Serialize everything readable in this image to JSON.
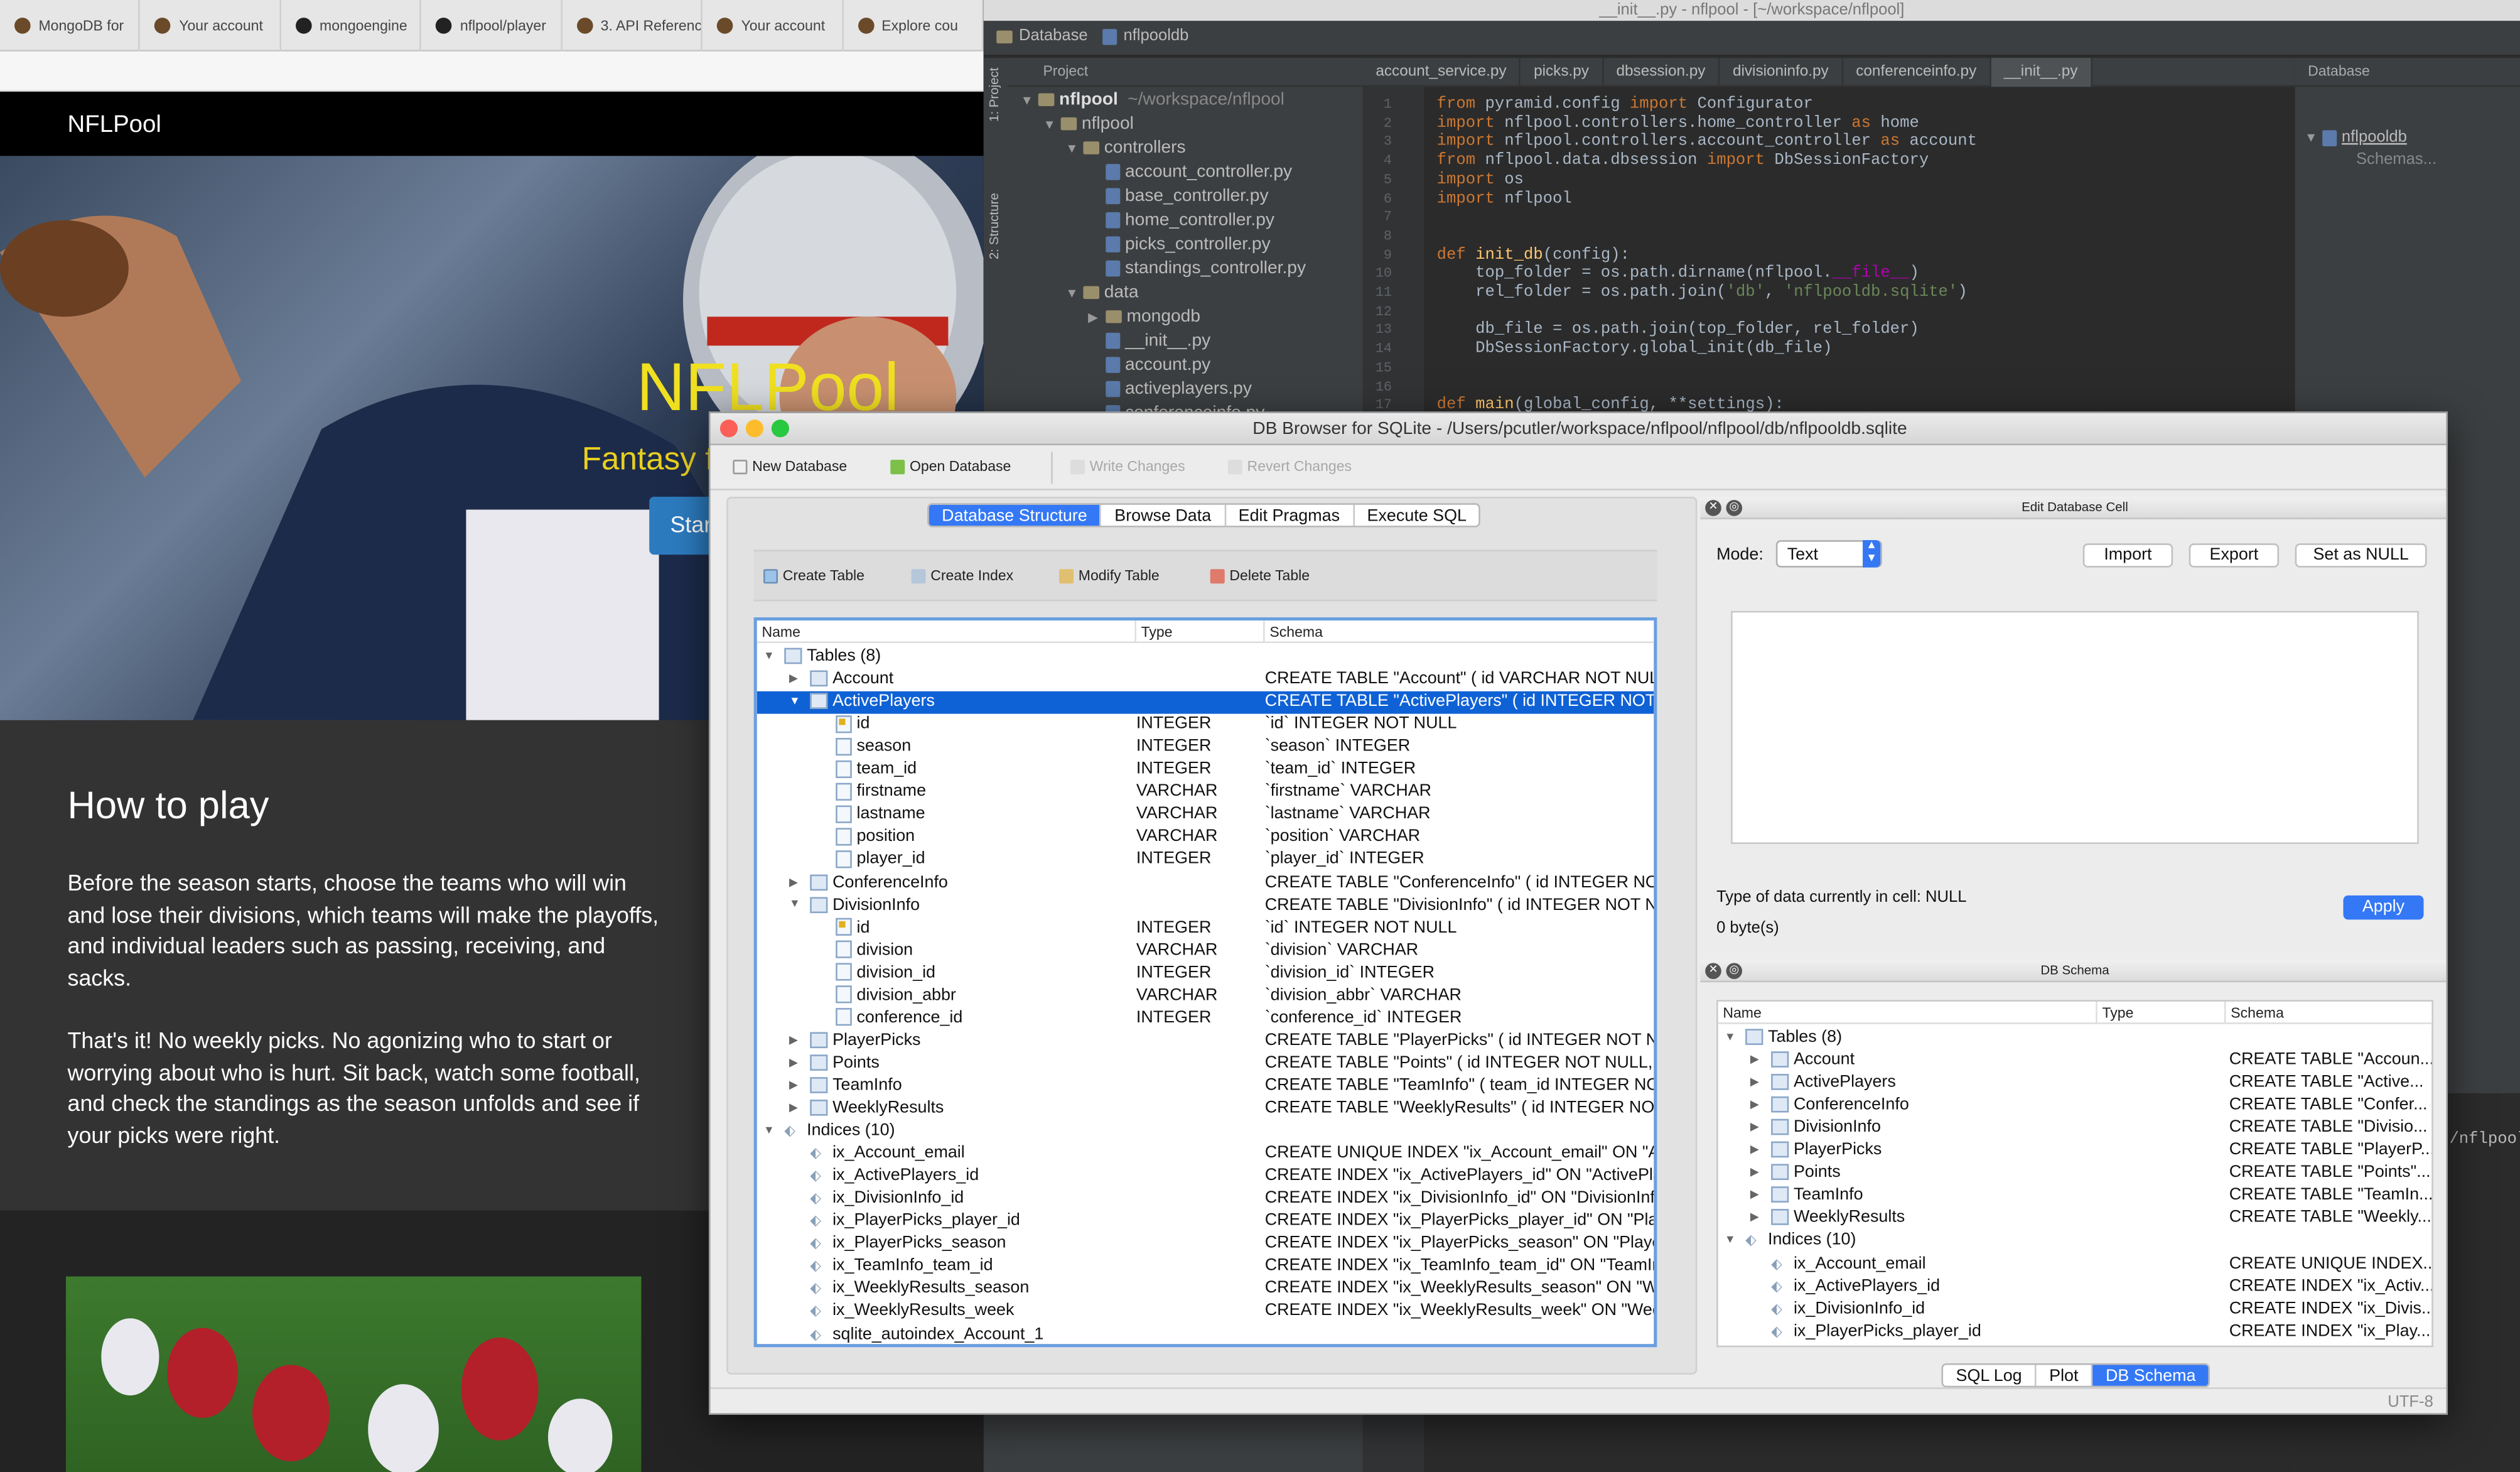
{
  "browser": {
    "tabs": [
      "MongoDB for",
      "Your account",
      "mongoengine",
      "nflpool/player",
      "3. API Reference",
      "Your account",
      "Explore cou"
    ],
    "brand": "NFLPool",
    "hero": {
      "title": "NFLPool",
      "subtitle": "Fantasy f",
      "button": "Star"
    },
    "howto": {
      "heading": "How to play",
      "p1": "Before the season starts, choose the teams who will win and lose their divisions, which teams will make the playoffs, and individual leaders such as passing, receiving, and sacks.",
      "p2": "That's it! No weekly picks. No agonizing who to start or worrying about who is hurt. Sit back, watch some football, and check the standings as the season unfolds and see if your picks were right."
    }
  },
  "ide": {
    "window_title": "__init__.py - nflpool - [~/workspace/nflpool]",
    "breadcrumb": [
      "Database",
      "nflpooldb"
    ],
    "side_tabs": [
      "1: Project",
      "2: Structure"
    ],
    "project_label": "Project",
    "root": {
      "name": "nflpool",
      "path": "~/workspace/nflpool"
    },
    "tree": [
      {
        "name": "nflpool",
        "kind": "folder",
        "depth": 1,
        "open": true
      },
      {
        "name": "controllers",
        "kind": "folder",
        "depth": 2,
        "open": true
      },
      {
        "name": "account_controller.py",
        "kind": "file",
        "depth": 3
      },
      {
        "name": "base_controller.py",
        "kind": "file",
        "depth": 3
      },
      {
        "name": "home_controller.py",
        "kind": "file",
        "depth": 3
      },
      {
        "name": "picks_controller.py",
        "kind": "file",
        "depth": 3
      },
      {
        "name": "standings_controller.py",
        "kind": "file",
        "depth": 3
      },
      {
        "name": "data",
        "kind": "folder",
        "depth": 2,
        "open": true
      },
      {
        "name": "mongodb",
        "kind": "folder",
        "depth": 3,
        "open": false
      },
      {
        "name": "__init__.py",
        "kind": "file",
        "depth": 3
      },
      {
        "name": "account.py",
        "kind": "file",
        "depth": 3
      },
      {
        "name": "activeplayers.py",
        "kind": "file",
        "depth": 3
      },
      {
        "name": "conferenceinfo.py",
        "kind": "file",
        "depth": 3
      }
    ],
    "editor_tabs": [
      "account_service.py",
      "picks.py",
      "dbsession.py",
      "divisioninfo.py",
      "conferenceinfo.py",
      "__init__.py"
    ],
    "code": [
      "from pyramid.config import Configurator",
      "import nflpool.controllers.home_controller as home",
      "import nflpool.controllers.account_controller as account",
      "from nflpool.data.dbsession import DbSessionFactory",
      "import os",
      "import nflpool",
      "",
      "",
      "def init_db(config):",
      "    top_folder = os.path.dirname(nflpool.__file__)",
      "    rel_folder = os.path.join('db', 'nflpooldb.sqlite')",
      "",
      "    db_file = os.path.join(top_folder, rel_folder)",
      "    DbSessionFactory.global_init(db_file)",
      "",
      "",
      "def main(global_config, **settings):"
    ],
    "db_panel": {
      "label": "Database",
      "item": "nflpooldb",
      "sub": "Schemas..."
    },
    "terminal_fragment": "/nflpool"
  },
  "dbb": {
    "title": "DB Browser for SQLite - /Users/pcutler/workspace/nflpool/nflpool/db/nflpooldb.sqlite",
    "toolbar": {
      "new_db": "New Database",
      "open_db": "Open Database",
      "write": "Write Changes",
      "revert": "Revert Changes"
    },
    "tabs": [
      "Database Structure",
      "Browse Data",
      "Edit Pragmas",
      "Execute SQL"
    ],
    "struct_tools": [
      "Create Table",
      "Create Index",
      "Modify Table",
      "Delete Table"
    ],
    "columns": [
      "Name",
      "Type",
      "Schema"
    ],
    "rows": [
      {
        "depth": 0,
        "arrow": "▼",
        "icon": "group",
        "name": "Tables (8)",
        "type": "",
        "schema": ""
      },
      {
        "depth": 1,
        "arrow": "▶",
        "icon": "table",
        "name": "Account",
        "type": "",
        "schema": "CREATE TABLE \"Account\" ( id VARCHAR NOT NULL"
      },
      {
        "depth": 1,
        "arrow": "▼",
        "icon": "table",
        "name": "ActivePlayers",
        "type": "",
        "schema": "CREATE TABLE \"ActivePlayers\" ( id INTEGER NOT N",
        "selected": true
      },
      {
        "depth": 2,
        "arrow": "",
        "icon": "key",
        "name": "id",
        "type": "INTEGER",
        "schema": "`id` INTEGER NOT NULL"
      },
      {
        "depth": 2,
        "arrow": "",
        "icon": "col",
        "name": "season",
        "type": "INTEGER",
        "schema": "`season` INTEGER"
      },
      {
        "depth": 2,
        "arrow": "",
        "icon": "col",
        "name": "team_id",
        "type": "INTEGER",
        "schema": "`team_id` INTEGER"
      },
      {
        "depth": 2,
        "arrow": "",
        "icon": "col",
        "name": "firstname",
        "type": "VARCHAR",
        "schema": "`firstname` VARCHAR"
      },
      {
        "depth": 2,
        "arrow": "",
        "icon": "col",
        "name": "lastname",
        "type": "VARCHAR",
        "schema": "`lastname` VARCHAR"
      },
      {
        "depth": 2,
        "arrow": "",
        "icon": "col",
        "name": "position",
        "type": "VARCHAR",
        "schema": "`position` VARCHAR"
      },
      {
        "depth": 2,
        "arrow": "",
        "icon": "col",
        "name": "player_id",
        "type": "INTEGER",
        "schema": "`player_id` INTEGER"
      },
      {
        "depth": 1,
        "arrow": "▶",
        "icon": "table",
        "name": "ConferenceInfo",
        "type": "",
        "schema": "CREATE TABLE \"ConferenceInfo\" ( id INTEGER NOT"
      },
      {
        "depth": 1,
        "arrow": "▼",
        "icon": "table",
        "name": "DivisionInfo",
        "type": "",
        "schema": "CREATE TABLE \"DivisionInfo\" ( id INTEGER NOT NU"
      },
      {
        "depth": 2,
        "arrow": "",
        "icon": "key",
        "name": "id",
        "type": "INTEGER",
        "schema": "`id` INTEGER NOT NULL"
      },
      {
        "depth": 2,
        "arrow": "",
        "icon": "col",
        "name": "division",
        "type": "VARCHAR",
        "schema": "`division` VARCHAR"
      },
      {
        "depth": 2,
        "arrow": "",
        "icon": "col",
        "name": "division_id",
        "type": "INTEGER",
        "schema": "`division_id` INTEGER"
      },
      {
        "depth": 2,
        "arrow": "",
        "icon": "col",
        "name": "division_abbr",
        "type": "VARCHAR",
        "schema": "`division_abbr` VARCHAR"
      },
      {
        "depth": 2,
        "arrow": "",
        "icon": "col",
        "name": "conference_id",
        "type": "INTEGER",
        "schema": "`conference_id` INTEGER"
      },
      {
        "depth": 1,
        "arrow": "▶",
        "icon": "table",
        "name": "PlayerPicks",
        "type": "",
        "schema": "CREATE TABLE \"PlayerPicks\" ( id INTEGER NOT NU"
      },
      {
        "depth": 1,
        "arrow": "▶",
        "icon": "table",
        "name": "Points",
        "type": "",
        "schema": "CREATE TABLE \"Points\" ( id INTEGER NOT NULL, at"
      },
      {
        "depth": 1,
        "arrow": "▶",
        "icon": "table",
        "name": "TeamInfo",
        "type": "",
        "schema": "CREATE TABLE \"TeamInfo\" ( team_id INTEGER NOT"
      },
      {
        "depth": 1,
        "arrow": "▶",
        "icon": "table",
        "name": "WeeklyResults",
        "type": "",
        "schema": "CREATE TABLE \"WeeklyResults\" ( id INTEGER NOT"
      },
      {
        "depth": 0,
        "arrow": "▼",
        "icon": "index-group",
        "name": "Indices (10)",
        "type": "",
        "schema": ""
      },
      {
        "depth": 1,
        "arrow": "",
        "icon": "index",
        "name": "ix_Account_email",
        "type": "",
        "schema": "CREATE UNIQUE INDEX \"ix_Account_email\" ON \"Ac"
      },
      {
        "depth": 1,
        "arrow": "",
        "icon": "index",
        "name": "ix_ActivePlayers_id",
        "type": "",
        "schema": "CREATE INDEX \"ix_ActivePlayers_id\" ON \"ActivePla"
      },
      {
        "depth": 1,
        "arrow": "",
        "icon": "index",
        "name": "ix_DivisionInfo_id",
        "type": "",
        "schema": "CREATE INDEX \"ix_DivisionInfo_id\" ON \"DivisionInfo"
      },
      {
        "depth": 1,
        "arrow": "",
        "icon": "index",
        "name": "ix_PlayerPicks_player_id",
        "type": "",
        "schema": "CREATE INDEX \"ix_PlayerPicks_player_id\" ON \"Playe"
      },
      {
        "depth": 1,
        "arrow": "",
        "icon": "index",
        "name": "ix_PlayerPicks_season",
        "type": "",
        "schema": "CREATE INDEX \"ix_PlayerPicks_season\" ON \"Player"
      },
      {
        "depth": 1,
        "arrow": "",
        "icon": "index",
        "name": "ix_TeamInfo_team_id",
        "type": "",
        "schema": "CREATE INDEX \"ix_TeamInfo_team_id\" ON \"TeamInf"
      },
      {
        "depth": 1,
        "arrow": "",
        "icon": "index",
        "name": "ix_WeeklyResults_season",
        "type": "",
        "schema": "CREATE INDEX \"ix_WeeklyResults_season\" ON \"We"
      },
      {
        "depth": 1,
        "arrow": "",
        "icon": "index",
        "name": "ix_WeeklyResults_week",
        "type": "",
        "schema": "CREATE INDEX \"ix_WeeklyResults_week\" ON \"Week"
      },
      {
        "depth": 1,
        "arrow": "",
        "icon": "index",
        "name": "sqlite_autoindex_Account_1",
        "type": "",
        "schema": ""
      }
    ],
    "edit_cell": {
      "title": "Edit Database Cell",
      "mode_label": "Mode:",
      "mode_value": "Text",
      "import": "Import",
      "export": "Export",
      "set_null": "Set as NULL",
      "type_text": "Type of data currently in cell: NULL",
      "size_text": "0 byte(s)",
      "apply": "Apply"
    },
    "schema_panel": {
      "title": "DB Schema",
      "columns": [
        "Name",
        "Type",
        "Schema"
      ],
      "rows": [
        {
          "depth": 0,
          "arrow": "▼",
          "icon": "group",
          "name": "Tables (8)",
          "schema": ""
        },
        {
          "depth": 1,
          "arrow": "▶",
          "icon": "table",
          "name": "Account",
          "schema": "CREATE TABLE \"Accoun..."
        },
        {
          "depth": 1,
          "arrow": "▶",
          "icon": "table",
          "name": "ActivePlayers",
          "schema": "CREATE TABLE \"Active..."
        },
        {
          "depth": 1,
          "arrow": "▶",
          "icon": "table",
          "name": "ConferenceInfo",
          "schema": "CREATE TABLE \"Confer..."
        },
        {
          "depth": 1,
          "arrow": "▶",
          "icon": "table",
          "name": "DivisionInfo",
          "schema": "CREATE TABLE \"Divisio..."
        },
        {
          "depth": 1,
          "arrow": "▶",
          "icon": "table",
          "name": "PlayerPicks",
          "schema": "CREATE TABLE \"PlayerP..."
        },
        {
          "depth": 1,
          "arrow": "▶",
          "icon": "table",
          "name": "Points",
          "schema": "CREATE TABLE \"Points\"..."
        },
        {
          "depth": 1,
          "arrow": "▶",
          "icon": "table",
          "name": "TeamInfo",
          "schema": "CREATE TABLE \"TeamIn..."
        },
        {
          "depth": 1,
          "arrow": "▶",
          "icon": "table",
          "name": "WeeklyResults",
          "schema": "CREATE TABLE \"Weekly..."
        },
        {
          "depth": 0,
          "arrow": "▼",
          "icon": "index-group",
          "name": "Indices (10)",
          "schema": ""
        },
        {
          "depth": 1,
          "arrow": "",
          "icon": "index",
          "name": "ix_Account_email",
          "schema": "CREATE UNIQUE INDEX..."
        },
        {
          "depth": 1,
          "arrow": "",
          "icon": "index",
          "name": "ix_ActivePlayers_id",
          "schema": "CREATE INDEX \"ix_Activ..."
        },
        {
          "depth": 1,
          "arrow": "",
          "icon": "index",
          "name": "ix_DivisionInfo_id",
          "schema": "CREATE INDEX \"ix_Divis..."
        },
        {
          "depth": 1,
          "arrow": "",
          "icon": "index",
          "name": "ix_PlayerPicks_player_id",
          "schema": "CREATE INDEX \"ix_Play..."
        }
      ]
    },
    "bottom_tabs": [
      "SQL Log",
      "Plot",
      "DB Schema"
    ],
    "encoding": "UTF-8"
  },
  "colors": {
    "accent": "#3478f6",
    "selection": "#0f62d6",
    "hero_yellow": "#f0e020"
  }
}
